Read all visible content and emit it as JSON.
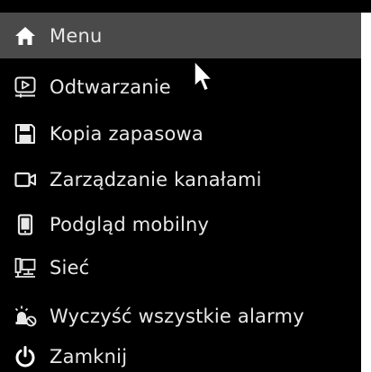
{
  "menu": {
    "header": {
      "label": "Menu",
      "icon": "home-icon"
    },
    "items": [
      {
        "label": "Odtwarzanie",
        "icon": "playback-icon"
      },
      {
        "label": "Kopia zapasowa",
        "icon": "save-icon"
      },
      {
        "label": "Zarządzanie kanałami",
        "icon": "camera-icon"
      },
      {
        "label": "Podgląd mobilny",
        "icon": "mobile-icon"
      },
      {
        "label": "Sieć",
        "icon": "network-icon"
      },
      {
        "label": "Wyczyść wszystkie alarmy",
        "icon": "clear-alarms-icon"
      },
      {
        "label": "Zamknij",
        "icon": "power-icon"
      }
    ]
  },
  "colors": {
    "background": "#000000",
    "header_highlight": "#4a4a4a",
    "text": "#e8e8e8",
    "icon": "#e8e8e8"
  },
  "cursor": {
    "icon": "mouse-pointer-icon"
  }
}
